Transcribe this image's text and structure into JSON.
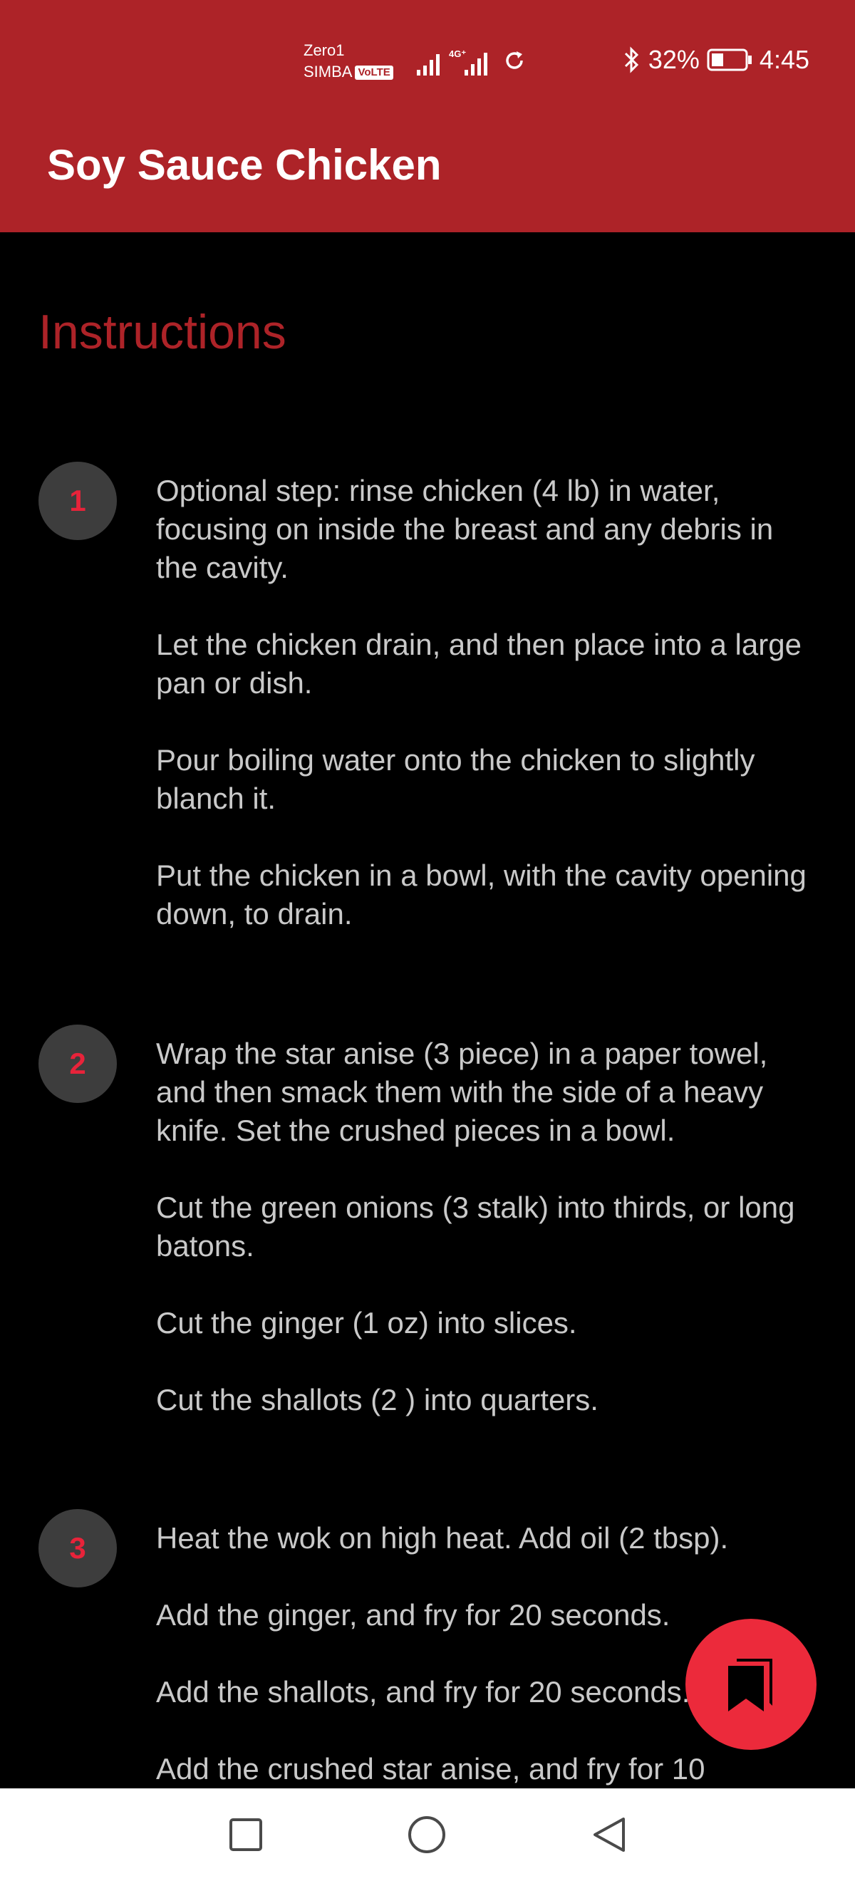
{
  "status_bar": {
    "carrier_line1": "Zero1",
    "carrier_line2": "SIMBA",
    "volte_label": "VoLTE",
    "battery_percent": "32%",
    "time": "4:45"
  },
  "header": {
    "title": "Soy Sauce Chicken"
  },
  "section": {
    "title": "Instructions"
  },
  "steps": [
    {
      "number": "1",
      "paragraphs": [
        "Optional step: rinse chicken (4 lb) in water, focusing on inside the breast and any debris in the cavity.",
        "Let the chicken drain, and then place into a large pan or dish.",
        "Pour boiling water onto the chicken to slightly blanch it.",
        "Put the chicken in a bowl, with the cavity opening down, to drain."
      ]
    },
    {
      "number": "2",
      "paragraphs": [
        "Wrap the star anise (3 piece) in a paper towel, and then smack them with the side of a heavy knife. Set the crushed pieces in a bowl.",
        "Cut the green onions (3 stalk) into thirds, or long batons.",
        "Cut the ginger (1 oz) into slices.",
        "Cut the shallots (2 ) into quarters."
      ]
    },
    {
      "number": "3",
      "paragraphs": [
        "Heat the wok on high heat. Add oil (2 tbsp).",
        "Add the ginger, and fry for 20 seconds.",
        "Add the shallots, and fry for 20 seconds.",
        "Add the crushed star anise, and fry for 10"
      ]
    }
  ],
  "fab": {
    "icon": "bookmark-icon"
  },
  "nav": {
    "recent": "square-icon",
    "home": "circle-icon",
    "back": "triangle-back-icon"
  },
  "colors": {
    "primary": "#ad2328",
    "accent": "#ec2a3b",
    "background": "#000000",
    "text": "#c9c9c9"
  }
}
